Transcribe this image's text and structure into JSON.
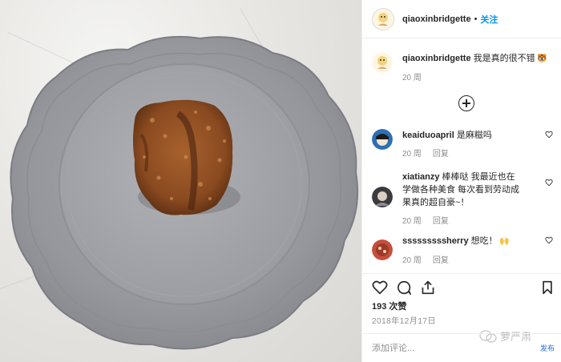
{
  "post": {
    "username": "qiaoxinbridgette",
    "follow_label": "关注"
  },
  "caption": {
    "username": "qiaoxinbridgette",
    "text": "我是真的很不错",
    "time": "20 周"
  },
  "comments": [
    {
      "username": "keaiduoapril",
      "text": "是麻糍吗",
      "time": "20 周",
      "reply": "回复"
    },
    {
      "username": "xiatianzy",
      "text": "棒棒哒 我最近也在学做各种美食 每次看到劳动成果真的超自豪~！",
      "time": "20 周",
      "reply": "回复"
    },
    {
      "username": "sssssssssherry",
      "text": "想吃！",
      "time": "20 周",
      "reply": "回复"
    }
  ],
  "likes": "193 次赞",
  "date": "2018年12月17日",
  "add_comment_placeholder": "添加评论...",
  "watermark": {
    "name": "萝严肃",
    "sub": "发布"
  },
  "icons": {
    "heart": "heart-icon",
    "comment": "comment-icon",
    "share": "share-icon",
    "bookmark": "bookmark-icon",
    "load_more": "plus-circle-icon"
  },
  "colors": {
    "link": "#0095f6",
    "muted": "#8e8e8e",
    "text": "#262626"
  }
}
